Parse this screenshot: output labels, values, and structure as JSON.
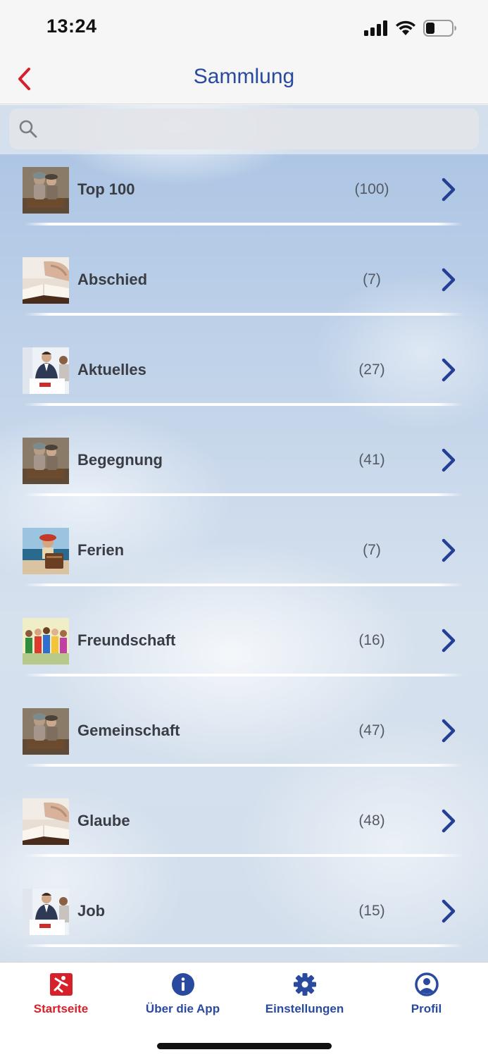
{
  "status_bar": {
    "time": "13:24"
  },
  "nav": {
    "title": "Sammlung"
  },
  "search": {
    "placeholder": ""
  },
  "list": {
    "items": [
      {
        "label": "Top 100",
        "count": "(100)",
        "thumb": "couple-thumbnail"
      },
      {
        "label": "Abschied",
        "count": "(7)",
        "thumb": "hands-bible-thumbnail"
      },
      {
        "label": "Aktuelles",
        "count": "(27)",
        "thumb": "office-meeting-thumbnail"
      },
      {
        "label": "Begegnung",
        "count": "(41)",
        "thumb": "couple-thumbnail"
      },
      {
        "label": "Ferien",
        "count": "(7)",
        "thumb": "beach-child-thumbnail"
      },
      {
        "label": "Freundschaft",
        "count": "(16)",
        "thumb": "children-group-thumbnail"
      },
      {
        "label": "Gemeinschaft",
        "count": "(47)",
        "thumb": "couple-thumbnail"
      },
      {
        "label": "Glaube",
        "count": "(48)",
        "thumb": "hands-bible-thumbnail"
      },
      {
        "label": "Job",
        "count": "(15)",
        "thumb": "office-meeting-thumbnail"
      }
    ]
  },
  "tabs": [
    {
      "label": "Startseite",
      "icon": "home-logo-icon",
      "active": true
    },
    {
      "label": "Über die App",
      "icon": "info-icon",
      "active": false
    },
    {
      "label": "Einstellungen",
      "icon": "gear-icon",
      "active": false
    },
    {
      "label": "Profil",
      "icon": "profile-icon",
      "active": false
    }
  ],
  "colors": {
    "accent_blue": "#2a4aa0",
    "accent_red": "#d6202a",
    "chevron_blue": "#253f94"
  }
}
